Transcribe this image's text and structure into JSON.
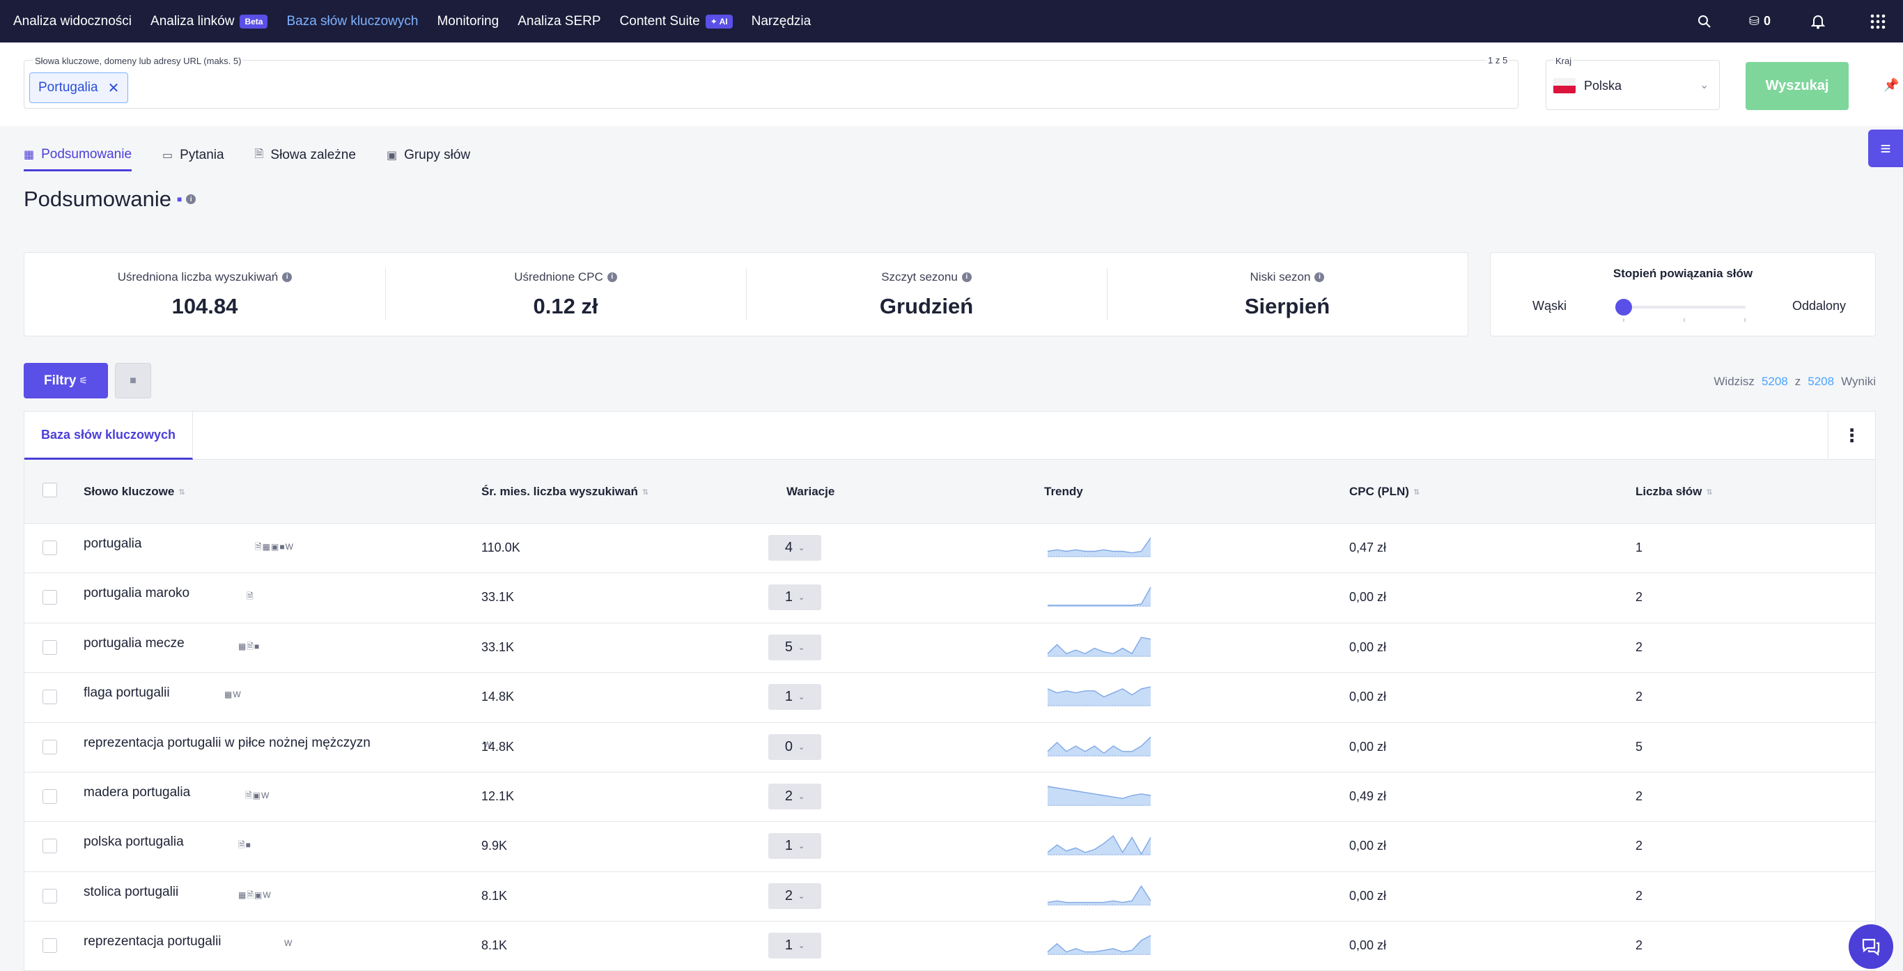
{
  "nav": {
    "items": [
      {
        "label": "Analiza widoczności"
      },
      {
        "label": "Analiza linków",
        "badge": "Beta"
      },
      {
        "label": "Baza słów kluczowych",
        "active": true
      },
      {
        "label": "Monitoring"
      },
      {
        "label": "Analiza SERP"
      },
      {
        "label": "Content Suite",
        "badge": "✦ AI"
      },
      {
        "label": "Narzędzia"
      }
    ],
    "credits": "0"
  },
  "search": {
    "label": "Słowa kluczowe, domeny lub adresy URL (maks. 5)",
    "count": "1 z 5",
    "chip": "Portugalia",
    "country_label": "Kraj",
    "country": "Polska",
    "button": "Wyszukaj"
  },
  "tabs": [
    "Podsumowanie",
    "Pytania",
    "Słowa zależne",
    "Grupy słów"
  ],
  "page_title": "Podsumowanie",
  "stats": [
    {
      "label": "Uśredniona liczba wyszukiwań",
      "value": "104.84"
    },
    {
      "label": "Uśrednione CPC",
      "value": "0.12 zł"
    },
    {
      "label": "Szczyt sezonu",
      "value": "Grudzień"
    },
    {
      "label": "Niski sezon",
      "value": "Sierpień"
    }
  ],
  "relation": {
    "title": "Stopień powiązania słów",
    "left": "Wąski",
    "right": "Oddalony"
  },
  "filters": {
    "label": "Filtry"
  },
  "results": {
    "prefix": "Widzisz",
    "shown": "5208",
    "of": "z",
    "total": "5208",
    "suffix": "Wyniki"
  },
  "table": {
    "tab": "Baza słów kluczowych",
    "columns": [
      "Słowo kluczowe",
      "Śr. mies. liczba wyszukiwań",
      "Wariacje",
      "Trendy",
      "CPC (PLN)",
      "Liczba słów"
    ],
    "rows": [
      {
        "keyword": "portugalia",
        "icons": "🗎▦▣■W",
        "volume": "110.0K",
        "variations": "4",
        "cpc": "0,47 zł",
        "words": "1",
        "trend": [
          3,
          4,
          3,
          4,
          3,
          3,
          4,
          3,
          3,
          2,
          3,
          12
        ]
      },
      {
        "keyword": "portugalia maroko",
        "icons": "🗎",
        "volume": "33.1K",
        "variations": "1",
        "cpc": "0,00 zł",
        "words": "2",
        "trend": [
          0,
          0,
          0,
          0,
          0,
          0,
          0,
          0,
          0,
          0,
          1,
          14
        ]
      },
      {
        "keyword": "portugalia mecze",
        "icons": "▦🗎■",
        "volume": "33.1K",
        "variations": "5",
        "cpc": "0,00 zł",
        "words": "2",
        "trend": [
          1,
          6,
          1,
          3,
          1,
          4,
          2,
          1,
          4,
          1,
          10,
          9
        ]
      },
      {
        "keyword": "flaga portugalii",
        "icons": "▦W",
        "volume": "14.8K",
        "variations": "1",
        "cpc": "0,00 zł",
        "words": "2",
        "trend": [
          8,
          6,
          7,
          6,
          7,
          7,
          4,
          6,
          8,
          5,
          8,
          9
        ]
      },
      {
        "keyword": "reprezentacja portugalii w piłce nożnej mężczyzn",
        "icons": "W",
        "volume": "14.8K",
        "variations": "0",
        "cpc": "0,00 zł",
        "words": "5",
        "trend": [
          2,
          7,
          2,
          5,
          2,
          5,
          1,
          5,
          2,
          2,
          5,
          10
        ]
      },
      {
        "keyword": "madera portugalia",
        "icons": "🗎▣W",
        "volume": "12.1K",
        "variations": "2",
        "cpc": "0,49 zł",
        "words": "2",
        "trend": [
          12,
          11,
          10,
          9,
          8,
          7,
          6,
          5,
          4,
          6,
          7,
          6
        ]
      },
      {
        "keyword": "polska portugalia",
        "icons": "🗎■",
        "volume": "9.9K",
        "variations": "1",
        "cpc": "0,00 zł",
        "words": "2",
        "trend": [
          1,
          6,
          2,
          4,
          1,
          3,
          7,
          12,
          1,
          11,
          0,
          11
        ]
      },
      {
        "keyword": "stolica portugalii",
        "icons": "▦🗎▣W",
        "volume": "8.1K",
        "variations": "2",
        "cpc": "0,00 zł",
        "words": "2",
        "trend": [
          1,
          2,
          1,
          1,
          1,
          1,
          1,
          2,
          1,
          2,
          11,
          2
        ]
      },
      {
        "keyword": "reprezentacja portugalii",
        "icons": "W",
        "volume": "8.1K",
        "variations": "1",
        "cpc": "0,00 zł",
        "words": "2",
        "trend": [
          1,
          6,
          1,
          3,
          1,
          1,
          2,
          3,
          1,
          2,
          8,
          11
        ]
      }
    ]
  },
  "colors": {
    "accent": "#5a4fe6",
    "nav_bg": "#1b1d3a",
    "search_btn": "#7ed69b",
    "link": "#4aa3ff",
    "spark_fill": "#c7dcf7",
    "spark_line": "#7fa8e6"
  }
}
